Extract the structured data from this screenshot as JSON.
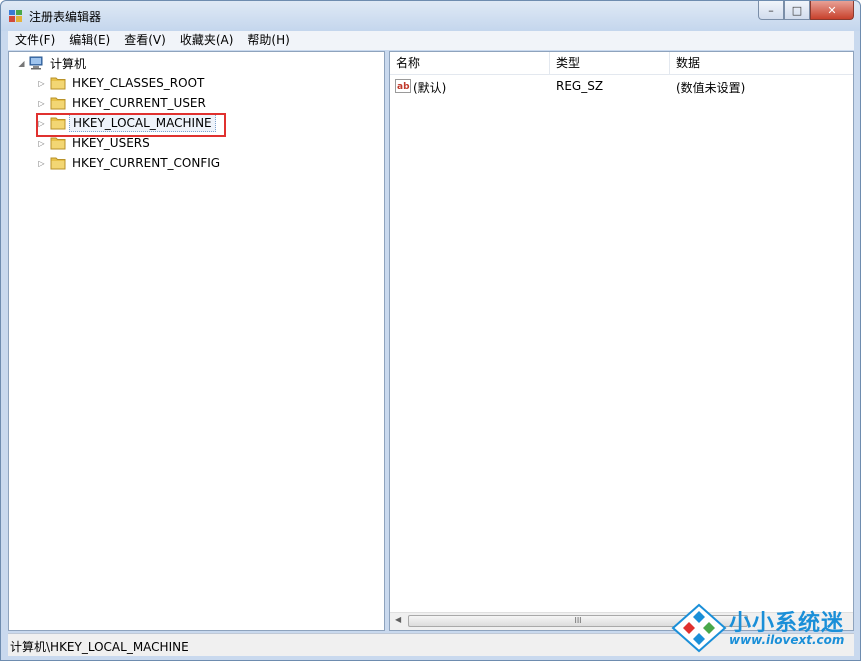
{
  "window": {
    "title": "注册表编辑器"
  },
  "window_controls": {
    "minimize": "–",
    "maximize": "□",
    "close": "✕"
  },
  "menu": [
    {
      "label": "文件(F)"
    },
    {
      "label": "编辑(E)"
    },
    {
      "label": "查看(V)"
    },
    {
      "label": "收藏夹(A)"
    },
    {
      "label": "帮助(H)"
    }
  ],
  "tree": {
    "root_label": "计算机",
    "items": [
      {
        "label": "HKEY_CLASSES_ROOT"
      },
      {
        "label": "HKEY_CURRENT_USER"
      },
      {
        "label": "HKEY_LOCAL_MACHINE",
        "selected": true
      },
      {
        "label": "HKEY_USERS"
      },
      {
        "label": "HKEY_CURRENT_CONFIG"
      }
    ]
  },
  "list": {
    "columns": [
      "名称",
      "类型",
      "数据"
    ],
    "rows": [
      {
        "name": "(默认)",
        "type": "REG_SZ",
        "data": "(数值未设置)"
      }
    ],
    "scroll_thumb_label": "III"
  },
  "status": {
    "path": "计算机\\HKEY_LOCAL_MACHINE"
  },
  "watermark": {
    "brand": "小小系统迷",
    "url": "www.ilovext.com"
  },
  "colors": {
    "highlight": "#e0312f",
    "watermark": "#1a8fd8"
  }
}
